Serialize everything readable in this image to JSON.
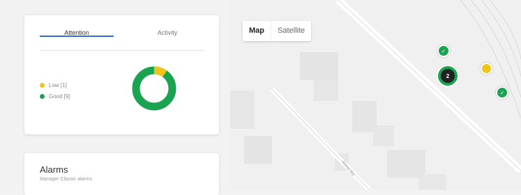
{
  "status_card": {
    "tabs": [
      {
        "label": "Attention",
        "active": true
      },
      {
        "label": "Activity",
        "active": false
      }
    ],
    "legend": [
      {
        "label": "Low [1]",
        "color": "#f0c419",
        "count": 1
      },
      {
        "label": "Good [9]",
        "color": "#1aa351",
        "count": 9
      }
    ],
    "accent": "#2f6fd0"
  },
  "alarms": {
    "title": "Alarms",
    "subtitle": "Manager Classic alarms"
  },
  "map": {
    "toggle": {
      "map_label": "Map",
      "satellite_label": "Satellite",
      "selected": "Map"
    },
    "road_label": "Amrer Rd",
    "markers": [
      {
        "type": "good",
        "icon": "check-icon"
      },
      {
        "type": "cluster",
        "count": "2"
      },
      {
        "type": "low"
      },
      {
        "type": "good",
        "icon": "check-icon"
      }
    ]
  }
}
